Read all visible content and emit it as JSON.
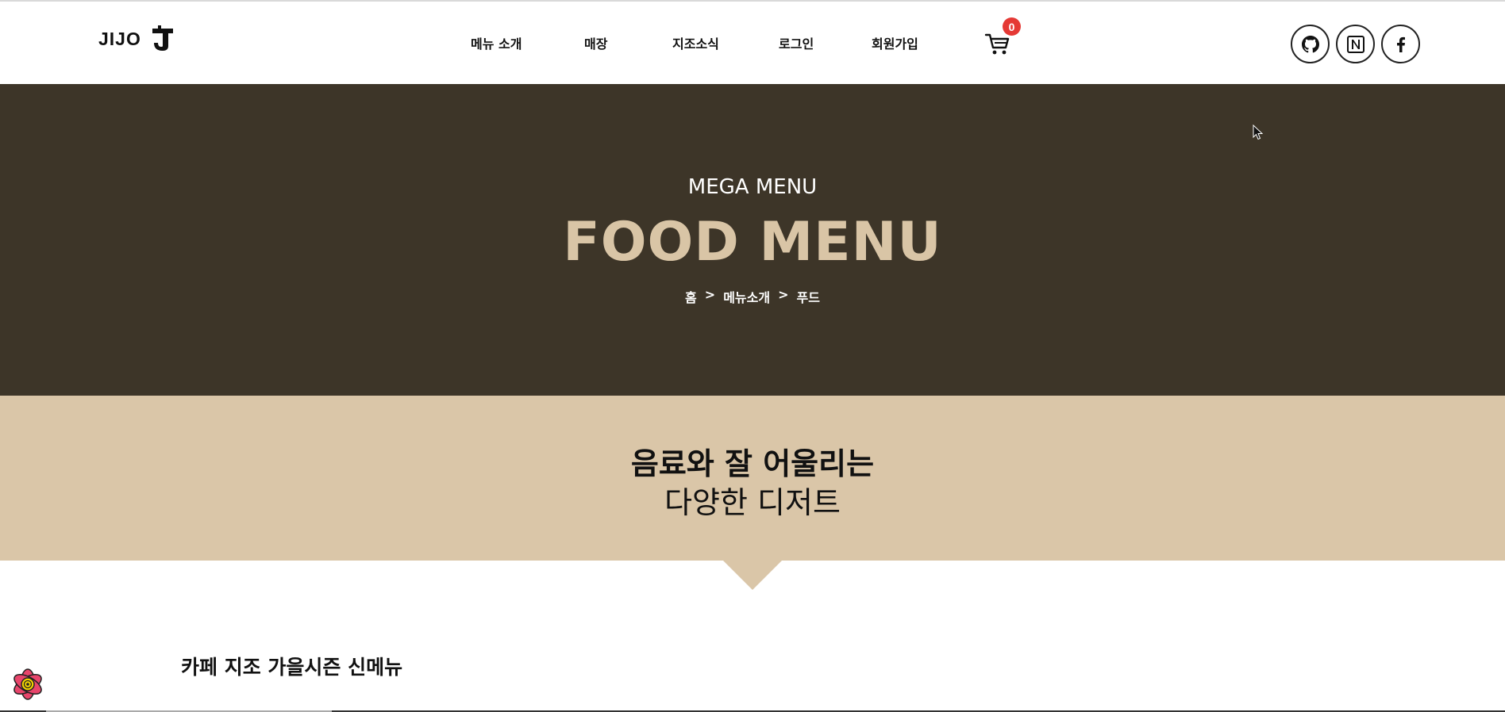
{
  "header": {
    "logo_text": "JIJO",
    "nav": [
      {
        "label": "메뉴 소개"
      },
      {
        "label": "매장"
      },
      {
        "label": "지조소식"
      },
      {
        "label": "로그인"
      },
      {
        "label": "회원가입"
      }
    ],
    "cart_count": "0",
    "social": [
      {
        "icon": "github-icon"
      },
      {
        "icon": "notion-icon"
      },
      {
        "icon": "facebook-icon"
      }
    ]
  },
  "hero": {
    "subtitle": "MEGA MENU",
    "title": "FOOD MENU",
    "breadcrumb": [
      "홈",
      ">",
      "메뉴소개",
      ">",
      "푸드"
    ]
  },
  "band": {
    "line1": "음료와 잘 어울리는",
    "line2": "다양한 디저트"
  },
  "section": {
    "title": "카페 지조 가을시즌 신메뉴"
  },
  "colors": {
    "hero_bg": "#3d3528",
    "accent": "#d9c5a6",
    "band_bg": "#dac6a8",
    "badge": "#e53935"
  }
}
